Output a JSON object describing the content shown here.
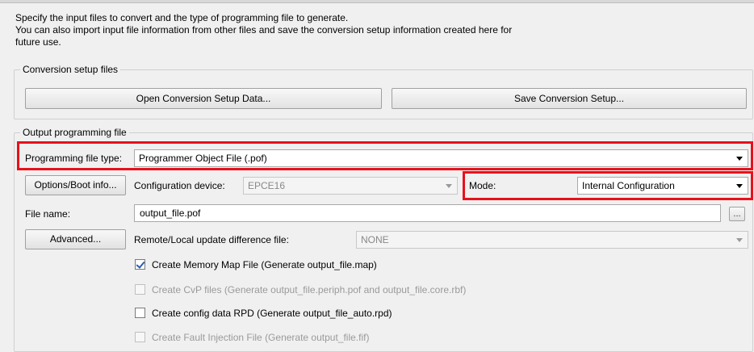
{
  "intro": {
    "line1": "Specify the input files to convert and the type of programming file to generate.",
    "line2": "You can also import input file information from other files and save the conversion setup information created here for",
    "line3": "future use."
  },
  "conversion_setup": {
    "legend": "Conversion setup files",
    "open_button": "Open Conversion Setup Data...",
    "save_button": "Save Conversion Setup..."
  },
  "output": {
    "legend": "Output programming file",
    "file_type_label": "Programming file type:",
    "file_type_value": "Programmer Object File (.pof)",
    "options_button": "Options/Boot info...",
    "config_device_label": "Configuration device:",
    "config_device_value": "EPCE16",
    "mode_label": "Mode:",
    "mode_value": "Internal Configuration",
    "file_name_label": "File name:",
    "file_name_value": "output_file.pof",
    "browse_button": "...",
    "advanced_button": "Advanced...",
    "update_diff_label": "Remote/Local update difference file:",
    "update_diff_value": "NONE"
  },
  "checkboxes": [
    {
      "label": "Create Memory Map File (Generate output_file.map)",
      "checked": true,
      "enabled": true
    },
    {
      "label": "Create CvP files (Generate output_file.periph.pof and output_file.core.rbf)",
      "checked": false,
      "enabled": false
    },
    {
      "label": "Create config data RPD (Generate output_file_auto.rpd)",
      "checked": false,
      "enabled": true
    },
    {
      "label": "Create Fault Injection File (Generate output_file.fif)",
      "checked": false,
      "enabled": false
    }
  ],
  "colors": {
    "highlight": "#e8111b",
    "check": "#2a5ea8"
  }
}
